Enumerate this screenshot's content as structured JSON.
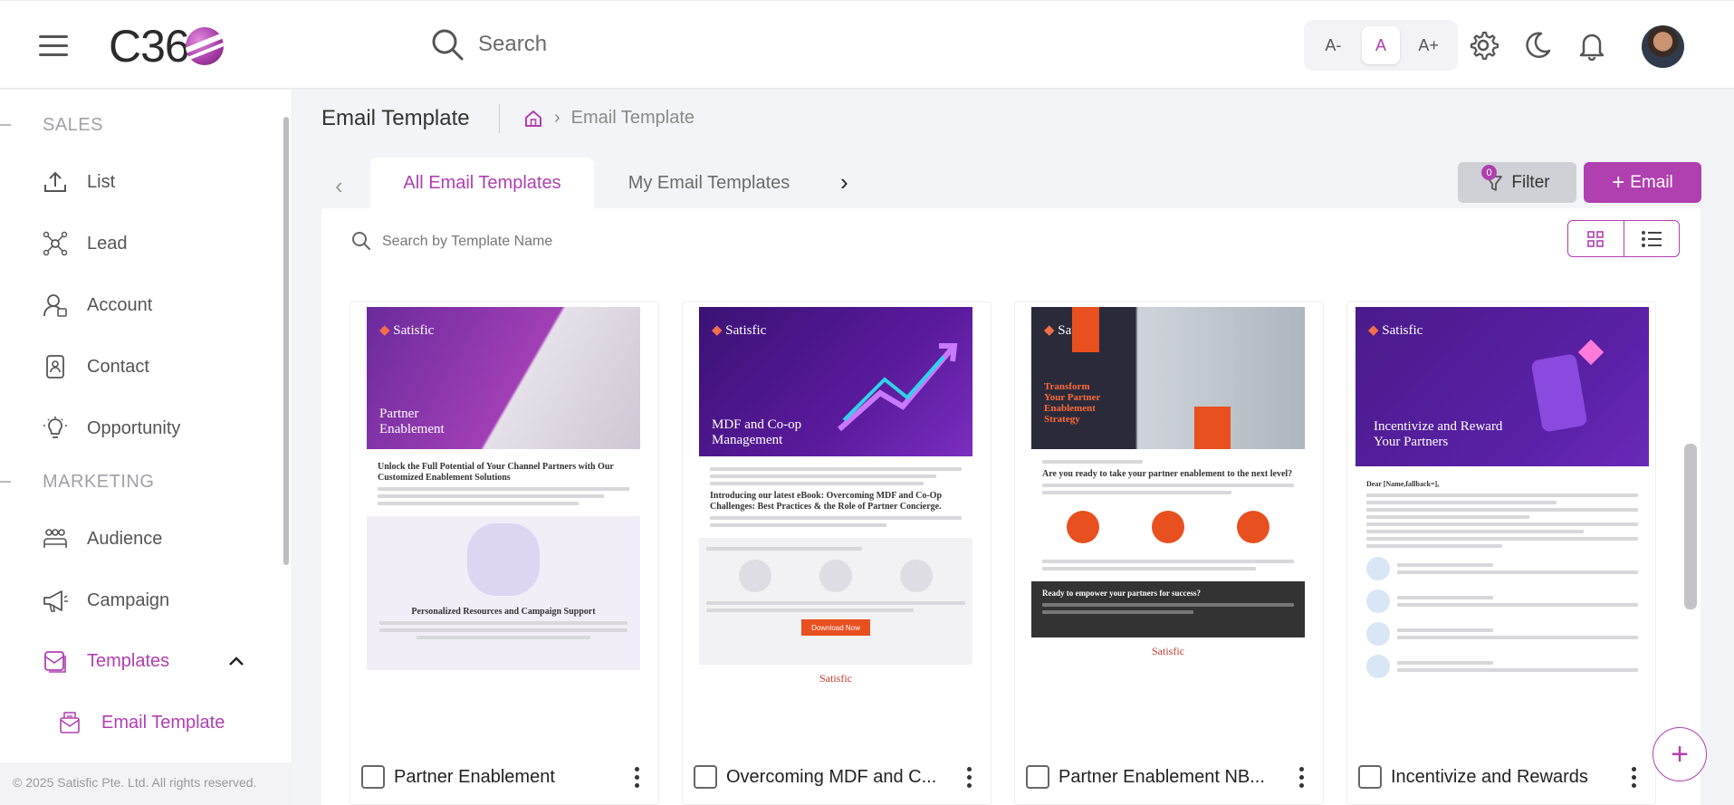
{
  "header": {
    "logo_text": "C36",
    "search_label": "Search",
    "font_controls": [
      "A-",
      "A",
      "A+"
    ]
  },
  "sidebar": {
    "section_sales": "SALES",
    "section_marketing": "MARKETING",
    "items": [
      {
        "label": "List",
        "icon": "upload-icon"
      },
      {
        "label": "Lead",
        "icon": "lead-network-icon"
      },
      {
        "label": "Account",
        "icon": "account-user-icon"
      },
      {
        "label": "Contact",
        "icon": "contact-card-icon"
      },
      {
        "label": "Opportunity",
        "icon": "lightbulb-icon"
      },
      {
        "label": "Audience",
        "icon": "audience-group-icon"
      },
      {
        "label": "Campaign",
        "icon": "megaphone-icon"
      },
      {
        "label": "Templates",
        "icon": "templates-icon"
      },
      {
        "label": "Email Template",
        "icon": "email-template-icon"
      }
    ],
    "footer": "© 2025 Satisfic Pte. Ltd. All rights reserved."
  },
  "main": {
    "page_title": "Email Template",
    "breadcrumb_current": "Email Template",
    "tabs": [
      "All Email Templates",
      "My Email Templates"
    ],
    "filter_label": "Filter",
    "filter_count": "0",
    "add_email_label": "Email",
    "search_placeholder": "Search by Template Name"
  },
  "cards": [
    {
      "name": "Partner Enablement",
      "brand": "Satisfic",
      "hero_title": "Partner\nEnablement",
      "heading": "Unlock the Full Potential of Your Channel Partners with Our Customized Enablement Solutions",
      "subheading": "Personalized Resources and Campaign Support"
    },
    {
      "name": "Overcoming MDF and C...",
      "brand": "Satisfic",
      "hero_title": "MDF and Co-op\nManagement",
      "heading": "Introducing our latest eBook: Overcoming MDF and Co-Op Challenges: Best Practices & the Role of Partner Concierge.",
      "cta": "Download Now"
    },
    {
      "name": "Partner Enablement NB...",
      "brand": "Satisfic",
      "hero_title": "Transform\nYour Partner\nEnablement\nStrategy",
      "heading": "Are you ready to take your partner enablement to the next level?",
      "banner": "Ready to empower your partners for success?"
    },
    {
      "name": "Incentivize and Rewards",
      "brand": "Satisfic",
      "hero_title": "Incentivize and Reward\nYour Partners",
      "heading": "Dear [Name,fallback=],"
    }
  ],
  "colors": {
    "accent": "#b03fb0",
    "hero_purple": "#4a1a8a",
    "orange": "#e8501f"
  }
}
